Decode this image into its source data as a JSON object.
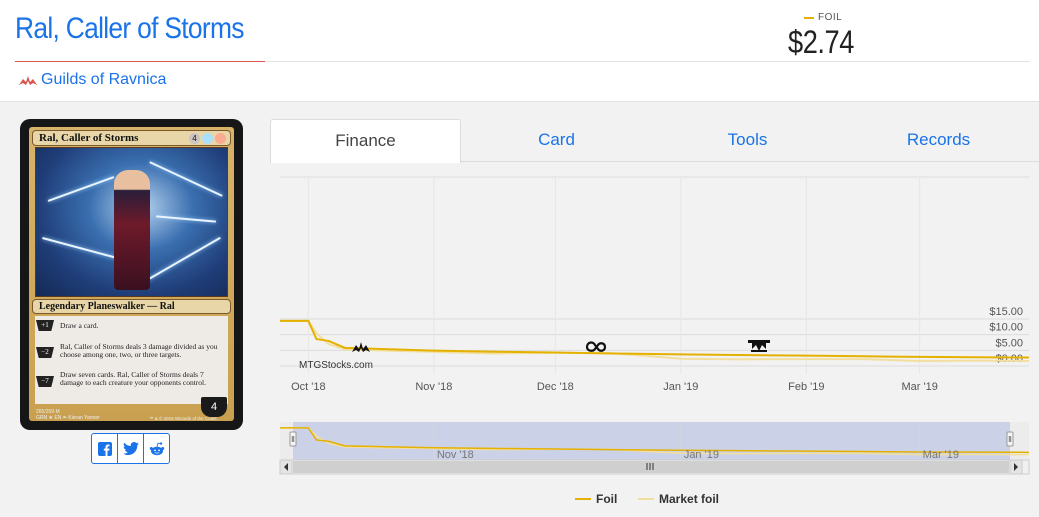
{
  "header": {
    "title": "Ral, Caller of Storms",
    "set_name": "Guilds of Ravnica",
    "foil_label": "FOIL",
    "foil_price": "$2.74"
  },
  "card_image": {
    "name": "Ral, Caller of Storms",
    "mana_cost": [
      "4",
      "U",
      "R"
    ],
    "type_line": "Legendary Planeswalker — Ral",
    "abilities": [
      {
        "cost": "+1",
        "text": "Draw a card."
      },
      {
        "cost": "−2",
        "text": "Ral, Caller of Storms deals 3 damage divided as you choose among one, two, or three targets."
      },
      {
        "cost": "−7",
        "text": "Draw seven cards. Ral, Caller of Storms deals 7 damage to each creature your opponents control."
      }
    ],
    "loyalty": "4",
    "collector_number": "265/259 M",
    "set_line": "GRN ★ EN",
    "artist": "Kieran Yanner",
    "copyright": "™ & © 2018 Wizards of the Coast"
  },
  "share": [
    {
      "icon": "facebook-icon"
    },
    {
      "icon": "twitter-icon"
    },
    {
      "icon": "reddit-icon"
    }
  ],
  "tabs": [
    {
      "label": "Finance",
      "active": true
    },
    {
      "label": "Card",
      "active": false
    },
    {
      "label": "Tools",
      "active": false
    },
    {
      "label": "Records",
      "active": false
    }
  ],
  "chart": {
    "watermark": "MTGStocks.com",
    "legend": [
      {
        "name": "Foil",
        "color": "#e5b100"
      },
      {
        "name": "Market foil",
        "color": "#f2dfa0"
      }
    ],
    "event_icons": [
      "guild-icon",
      "set-symbol-icon",
      "set-symbol-icon"
    ],
    "navigator_labels": [
      "Nov '18",
      "Jan '19",
      "Mar '19"
    ]
  },
  "chart_data": {
    "type": "line",
    "x_tick_labels": [
      "Oct '18",
      "Nov '18",
      "Dec '18",
      "Jan '19",
      "Feb '19",
      "Mar '19"
    ],
    "y_tick_labels": [
      "$0.00",
      "$5.00",
      "$10.00",
      "$15.00"
    ],
    "ylim": [
      0,
      15
    ],
    "grid": true,
    "legend_position": "bottom",
    "x_dates": [
      "2018-09-24",
      "2018-09-28",
      "2018-10-01",
      "2018-10-03",
      "2018-10-06",
      "2018-10-10",
      "2018-10-20",
      "2018-11-01",
      "2018-11-15",
      "2018-12-01",
      "2018-12-15",
      "2019-01-01",
      "2019-01-15",
      "2019-02-01",
      "2019-02-15",
      "2019-03-01",
      "2019-03-15",
      "2019-03-28"
    ],
    "series": [
      {
        "name": "Foil",
        "color": "#e5b100",
        "values": [
          14.4,
          14.4,
          14.4,
          8.6,
          8.0,
          5.8,
          5.4,
          4.9,
          4.6,
          4.3,
          4.0,
          3.7,
          3.5,
          3.3,
          3.1,
          2.9,
          2.8,
          2.7
        ]
      },
      {
        "name": "Market foil",
        "color": "#f2dfa0",
        "values": [
          14.4,
          14.4,
          14.4,
          10.5,
          7.0,
          5.3,
          4.9,
          4.5,
          4.0,
          4.2,
          4.1,
          2.3,
          2.1,
          2.2,
          2.2,
          1.6,
          1.7,
          1.6
        ]
      }
    ]
  }
}
